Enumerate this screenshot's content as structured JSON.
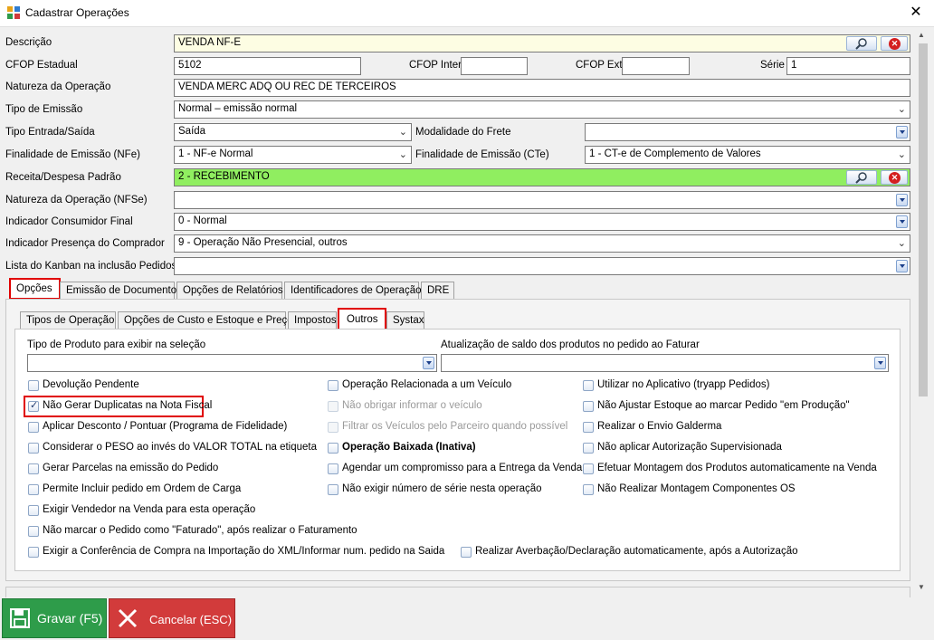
{
  "window": {
    "title": "Cadastrar Operações",
    "close": "✕"
  },
  "form": {
    "descricao": {
      "label": "Descrição",
      "value": "VENDA NF-E"
    },
    "cfop_estadual": {
      "label": "CFOP Estadual",
      "value": "5102"
    },
    "cfop_inter": {
      "label": "CFOP Inter",
      "value": ""
    },
    "cfop_ext": {
      "label": "CFOP Ext",
      "value": ""
    },
    "serie": {
      "label": "Série",
      "value": "1"
    },
    "natureza": {
      "label": "Natureza da Operação",
      "value": "VENDA MERC ADQ OU REC DE TERCEIROS"
    },
    "tipo_emissao": {
      "label": "Tipo de Emissão",
      "value": "Normal – emissão normal"
    },
    "tipo_es": {
      "label": "Tipo Entrada/Saída",
      "value": "Saída"
    },
    "modalidade_frete": {
      "label": "Modalidade do Frete",
      "value": ""
    },
    "finalidade_nfe": {
      "label": "Finalidade de Emissão (NFe)",
      "value": "1 - NF-e Normal"
    },
    "finalidade_cte": {
      "label": "Finalidade de Emissão (CTe)",
      "value": "1 - CT-e de Complemento de Valores"
    },
    "receita": {
      "label": "Receita/Despesa Padrão",
      "value": "2 - RECEBIMENTO"
    },
    "natureza_nfse": {
      "label": "Natureza da Operação (NFSe)",
      "value": ""
    },
    "consumidor": {
      "label": "Indicador Consumidor Final",
      "value": "0 - Normal"
    },
    "presenca": {
      "label": "Indicador Presença do Comprador",
      "value": "9 - Operação Não Presencial, outros"
    },
    "kanban": {
      "label": "Lista do Kanban na inclusão Pedidos",
      "value": ""
    }
  },
  "tabs": {
    "t1": "Opções",
    "t2": "Emissão de Documentos",
    "t3": "Opções de Relatórios",
    "t4": "Identificadores de Operação",
    "t5": "DRE"
  },
  "subtabs": {
    "s1": "Tipos de Operação",
    "s2": "Opções de Custo e Estoque e Preço",
    "s3": "Impostos",
    "s4": "Outros",
    "s5": "Systax"
  },
  "outros": {
    "tipo_produto_label": "Tipo de Produto para exibir na seleção",
    "atualizacao_label": "Atualização de saldo dos produtos no pedido ao Faturar",
    "checks": [
      "Devolução Pendente",
      "Não Gerar Duplicatas na Nota Fiscal",
      "Aplicar Desconto / Pontuar (Programa de Fidelidade)",
      "Considerar o PESO ao invés do VALOR TOTAL na etiqueta",
      "Gerar Parcelas na emissão do Pedido",
      "Permite Incluir pedido em Ordem de Carga",
      "Exigir Vendedor na Venda para esta operação",
      "Não marcar o Pedido como \"Faturado\", após realizar o Faturamento",
      "Exigir a Conferência de Compra na Importação do XML/Informar num. pedido na Saida",
      "Operação Relacionada a um Veículo",
      "Não obrigar informar o veículo",
      "Filtrar os Veículos pelo Parceiro quando possível",
      "Operação Baixada (Inativa)",
      "Agendar um compromisso para a Entrega da Venda",
      "Não exigir número de série nesta operação",
      "Realizar Averbação/Declaração automaticamente, após a Autorização",
      "Utilizar no Aplicativo (tryapp Pedidos)",
      "Não Ajustar Estoque ao marcar Pedido \"em Produção\"",
      "Realizar o Envio Galderma",
      "Não aplicar Autorização Supervisionada",
      "Efetuar Montagem dos Produtos automaticamente na Venda",
      "Não Realizar Montagem Componentes OS"
    ]
  },
  "footer": {
    "save": "Gravar (F5)",
    "cancel": "Cancelar (ESC)"
  }
}
